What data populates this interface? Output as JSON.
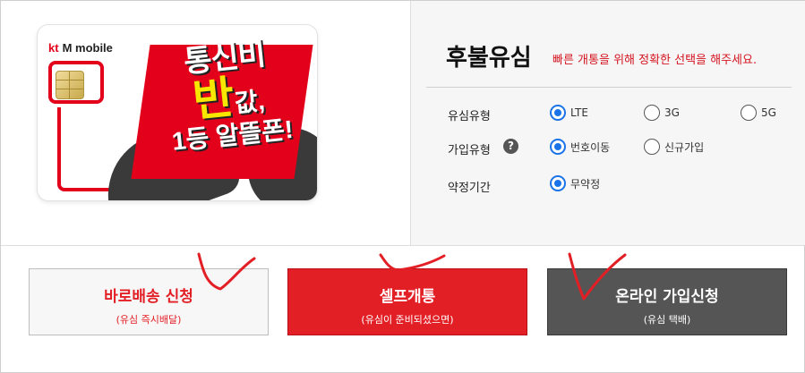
{
  "product_image": {
    "brand_kt": "kt",
    "brand_mobile": "M mobile",
    "promo_line1": "통신비",
    "promo_line2_big": "반",
    "promo_line2_small": "값,",
    "promo_line3": "1등 알뜰폰!"
  },
  "header": {
    "title": "후불유심",
    "subtitle": "빠른 개통을 위해 정확한 선택을 해주세요."
  },
  "form": {
    "sim_type": {
      "label": "유심유형",
      "options": [
        "LTE",
        "3G",
        "5G"
      ],
      "selected": "LTE"
    },
    "join_type": {
      "label": "가입유형",
      "help": "?",
      "options": [
        "번호이동",
        "신규가입"
      ],
      "selected": "번호이동"
    },
    "contract": {
      "label": "약정기간",
      "options": [
        "무약정"
      ],
      "selected": "무약정"
    }
  },
  "actions": {
    "express": {
      "label": "바로배송 신청",
      "sub": "(유심 즉시배달)"
    },
    "self": {
      "label": "셀프개통",
      "sub": "(유심이 준비되셨으면)"
    },
    "online": {
      "label": "온라인 가입신청",
      "sub": "(유심 택배)"
    }
  },
  "colors": {
    "accent_red": "#e31f26",
    "radio_blue": "#1a73e8",
    "dark_button": "#555555"
  }
}
